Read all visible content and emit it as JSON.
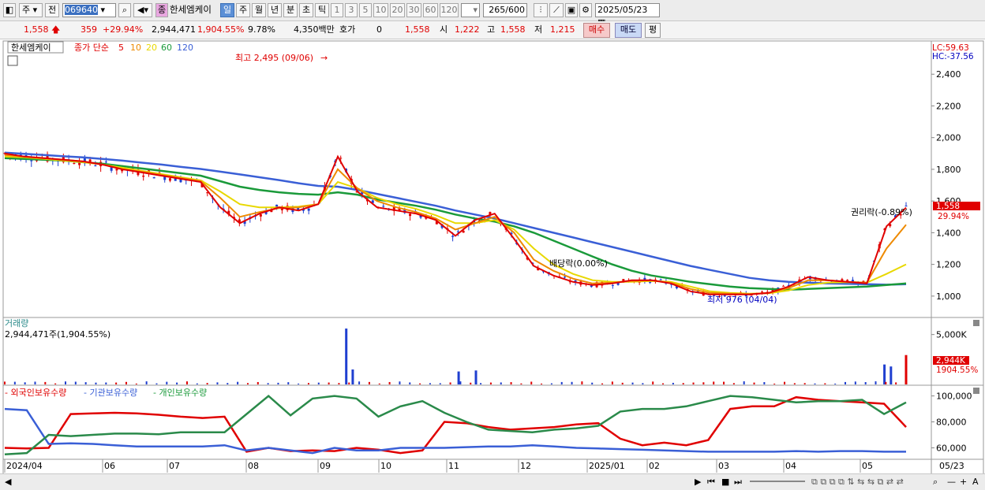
{
  "toolbar": {
    "market": "주",
    "prev": "전",
    "code": "069640",
    "tag": "종",
    "name": "한세엠케이",
    "periods": [
      "일",
      "주",
      "월",
      "년",
      "분",
      "초",
      "틱"
    ],
    "active_period": "일",
    "numbers": [
      "1",
      "3",
      "5",
      "10",
      "20",
      "30",
      "60",
      "120"
    ],
    "count": "265",
    "count_total": "/600",
    "date": "2025/05/23"
  },
  "quote": {
    "price": "1,558",
    "change": "359",
    "change_pct": "+29.94%",
    "volume": "2,944,471",
    "volume_pct": "1,904.55%",
    "turnover": "9.78%",
    "amount": "4,350백만",
    "hoga_label": "호가",
    "hoga": "0",
    "hoga_price": "1,558",
    "open_label": "시",
    "open": "1,222",
    "high_label": "고",
    "high": "1,558",
    "low_label": "저",
    "low": "1,215",
    "buy": "매수",
    "sell": "매도",
    "eval": "평"
  },
  "legend": {
    "name": "한세엠케이",
    "desc": "종가 단순",
    "ma": [
      {
        "label": "5",
        "color": "#e00000"
      },
      {
        "label": "10",
        "color": "#ee8a00"
      },
      {
        "label": "20",
        "color": "#e8d800"
      },
      {
        "label": "60",
        "color": "#1a9a3a"
      },
      {
        "label": "120",
        "color": "#3a5fd6"
      }
    ]
  },
  "annotations": {
    "high": "최고 2,495 (09/06)",
    "low": "최저 976 (04/04)",
    "dividend": "배당락(0.00%)",
    "rights": "권리락(-0.89%)",
    "lc": "LC:59.63",
    "hc": "HC:-37.56",
    "last_price": "1,558",
    "last_pct": "29.94%",
    "vol_title": "거래량",
    "vol_value": "2,944,471주(1,904.55%)",
    "vol_last": "2,944K",
    "vol_last_pct": "1904.55%",
    "own_foreign": "외국인보유수량",
    "own_inst": "기관보유수량",
    "own_indiv": "개인보유수량"
  },
  "chart_data": [
    {
      "type": "candlestick",
      "title": "한세엠케이",
      "y_ticks": [
        1000,
        1200,
        1400,
        1600,
        1800,
        2000,
        2200,
        2400
      ],
      "ylim": [
        880,
        2580
      ],
      "x_ticks": [
        "2024/04",
        "06",
        "07",
        "08",
        "09",
        "10",
        "11",
        "12",
        "2025/01",
        "02",
        "03",
        "04",
        "05",
        "05/23"
      ],
      "series": [
        {
          "name": "5",
          "values": [
            1900,
            1880,
            1870,
            1860,
            1850,
            1830,
            1800,
            1780,
            1760,
            1740,
            1720,
            1560,
            1460,
            1520,
            1560,
            1540,
            1580,
            1880,
            1660,
            1560,
            1540,
            1520,
            1480,
            1380,
            1480,
            1520,
            1360,
            1190,
            1130,
            1090,
            1070,
            1080,
            1100,
            1100,
            1080,
            1030,
            1010,
            1010,
            1010,
            1020,
            1060,
            1120,
            1100,
            1090,
            1080,
            1440,
            1558
          ]
        },
        {
          "name": "10",
          "values": [
            1890,
            1880,
            1870,
            1860,
            1850,
            1830,
            1800,
            1785,
            1765,
            1745,
            1725,
            1620,
            1500,
            1530,
            1555,
            1560,
            1580,
            1800,
            1680,
            1600,
            1560,
            1530,
            1490,
            1420,
            1460,
            1500,
            1400,
            1230,
            1160,
            1110,
            1080,
            1085,
            1095,
            1100,
            1085,
            1045,
            1020,
            1015,
            1012,
            1020,
            1050,
            1100,
            1100,
            1090,
            1085,
            1300,
            1450
          ]
        },
        {
          "name": "20",
          "values": [
            1880,
            1875,
            1865,
            1855,
            1845,
            1830,
            1810,
            1790,
            1770,
            1750,
            1730,
            1660,
            1580,
            1560,
            1560,
            1565,
            1580,
            1720,
            1680,
            1620,
            1580,
            1550,
            1510,
            1460,
            1460,
            1480,
            1420,
            1300,
            1200,
            1140,
            1100,
            1090,
            1090,
            1095,
            1090,
            1060,
            1030,
            1020,
            1015,
            1018,
            1035,
            1070,
            1085,
            1088,
            1085,
            1140,
            1200
          ]
        },
        {
          "name": "60",
          "values": [
            1870,
            1865,
            1860,
            1855,
            1845,
            1835,
            1820,
            1805,
            1790,
            1775,
            1760,
            1725,
            1690,
            1670,
            1655,
            1645,
            1640,
            1655,
            1640,
            1610,
            1590,
            1570,
            1545,
            1515,
            1490,
            1470,
            1440,
            1400,
            1350,
            1300,
            1250,
            1200,
            1160,
            1130,
            1110,
            1090,
            1075,
            1060,
            1050,
            1045,
            1040,
            1045,
            1050,
            1055,
            1060,
            1070,
            1080
          ]
        },
        {
          "name": "120",
          "values": [
            1905,
            1898,
            1890,
            1882,
            1875,
            1865,
            1855,
            1842,
            1830,
            1815,
            1802,
            1785,
            1768,
            1750,
            1732,
            1712,
            1695,
            1690,
            1670,
            1645,
            1620,
            1595,
            1570,
            1540,
            1515,
            1490,
            1460,
            1430,
            1400,
            1370,
            1340,
            1310,
            1280,
            1250,
            1220,
            1190,
            1165,
            1140,
            1115,
            1100,
            1090,
            1085,
            1080,
            1078,
            1075,
            1072,
            1075
          ]
        }
      ]
    },
    {
      "type": "bar",
      "title": "거래량",
      "y_ticks": [
        5000000
      ],
      "x": [
        "2024/09/06",
        "2024/09/09",
        "2024/10/28",
        "2024/11/05",
        "2025/05/13",
        "2025/05/16",
        "2025/05/23"
      ],
      "values": [
        5600000,
        1500000,
        1300000,
        1400000,
        2000000,
        1800000,
        2944471
      ]
    },
    {
      "type": "line",
      "title": "보유수량",
      "y_ticks": [
        60000,
        80000,
        100000
      ],
      "series": [
        {
          "name": "외국인보유수량",
          "values": [
            60000,
            59500,
            60000,
            86000,
            86500,
            87000,
            86500,
            85500,
            84000,
            83000,
            84000,
            57000,
            60000,
            57500,
            58000,
            57500,
            60000,
            58500,
            56000,
            58000,
            80000,
            79000,
            76000,
            74000,
            75000,
            76000,
            78000,
            79000,
            67000,
            62000,
            64000,
            62000,
            66000,
            90000,
            92000,
            92000,
            99000,
            97000,
            96000,
            95000,
            94000,
            76000
          ]
        },
        {
          "name": "기관보유수량",
          "values": [
            90000,
            89000,
            63000,
            63500,
            63000,
            62000,
            61000,
            61000,
            61000,
            61000,
            62000,
            58000,
            60000,
            58000,
            56000,
            60000,
            58000,
            58000,
            60000,
            60000,
            60000,
            60500,
            61000,
            61000,
            62000,
            61000,
            60000,
            59500,
            59000,
            58500,
            58000,
            57500,
            57000,
            57000,
            57000,
            57000,
            57500,
            57000,
            57500,
            57500,
            57000,
            57000
          ]
        },
        {
          "name": "개인보유수량",
          "values": [
            55000,
            56000,
            70000,
            69000,
            70000,
            71000,
            71000,
            70500,
            72000,
            72000,
            72000,
            86000,
            100000,
            85000,
            98000,
            100000,
            98000,
            84000,
            92000,
            96000,
            87000,
            80000,
            74000,
            73000,
            72000,
            74000,
            75000,
            77000,
            88000,
            90000,
            90000,
            92000,
            96000,
            100000,
            99000,
            97000,
            95000,
            96000,
            96000,
            97000,
            86000,
            95000
          ]
        }
      ]
    }
  ]
}
